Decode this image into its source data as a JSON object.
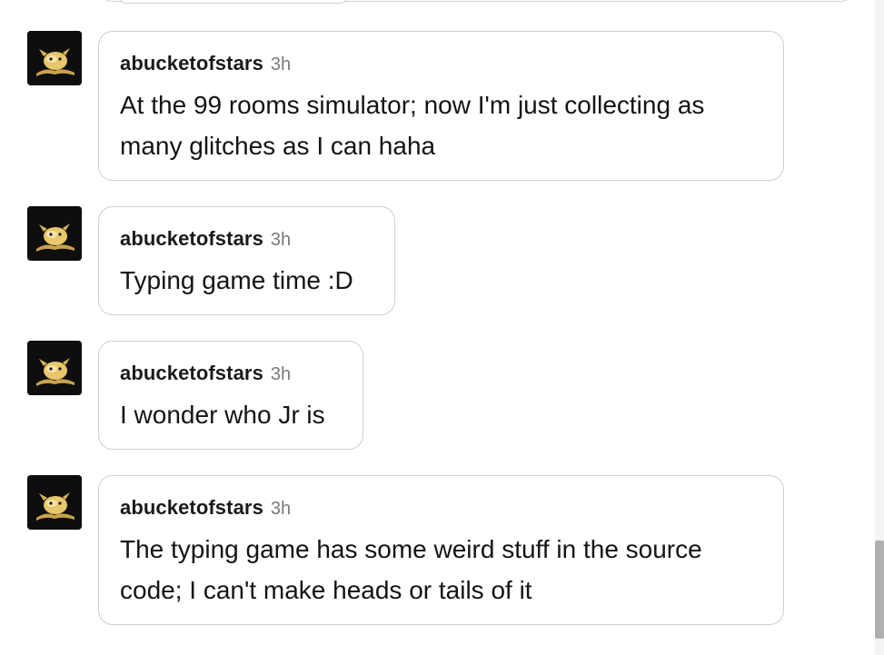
{
  "messages": [
    {
      "username": "abucketofstars",
      "time": "3h",
      "text": "At the 99 rooms simulator; now I'm just collecting as many glitches as I can haha"
    },
    {
      "username": "abucketofstars",
      "time": "3h",
      "text": "Typing game time :D"
    },
    {
      "username": "abucketofstars",
      "time": "3h",
      "text": "I wonder who Jr is"
    },
    {
      "username": "abucketofstars",
      "time": "3h",
      "text": "The typing game has some weird stuff in the source code; I can't make heads or tails of it"
    }
  ],
  "colors": {
    "bubble_border": "#cfcfcf",
    "username": "#1a1a1a",
    "time": "#7a7a7a",
    "avatar_bg": "#0e0e0e",
    "avatar_creature": "#e8c66a"
  },
  "icons": {
    "avatar": "octopus-creature-avatar-icon"
  }
}
